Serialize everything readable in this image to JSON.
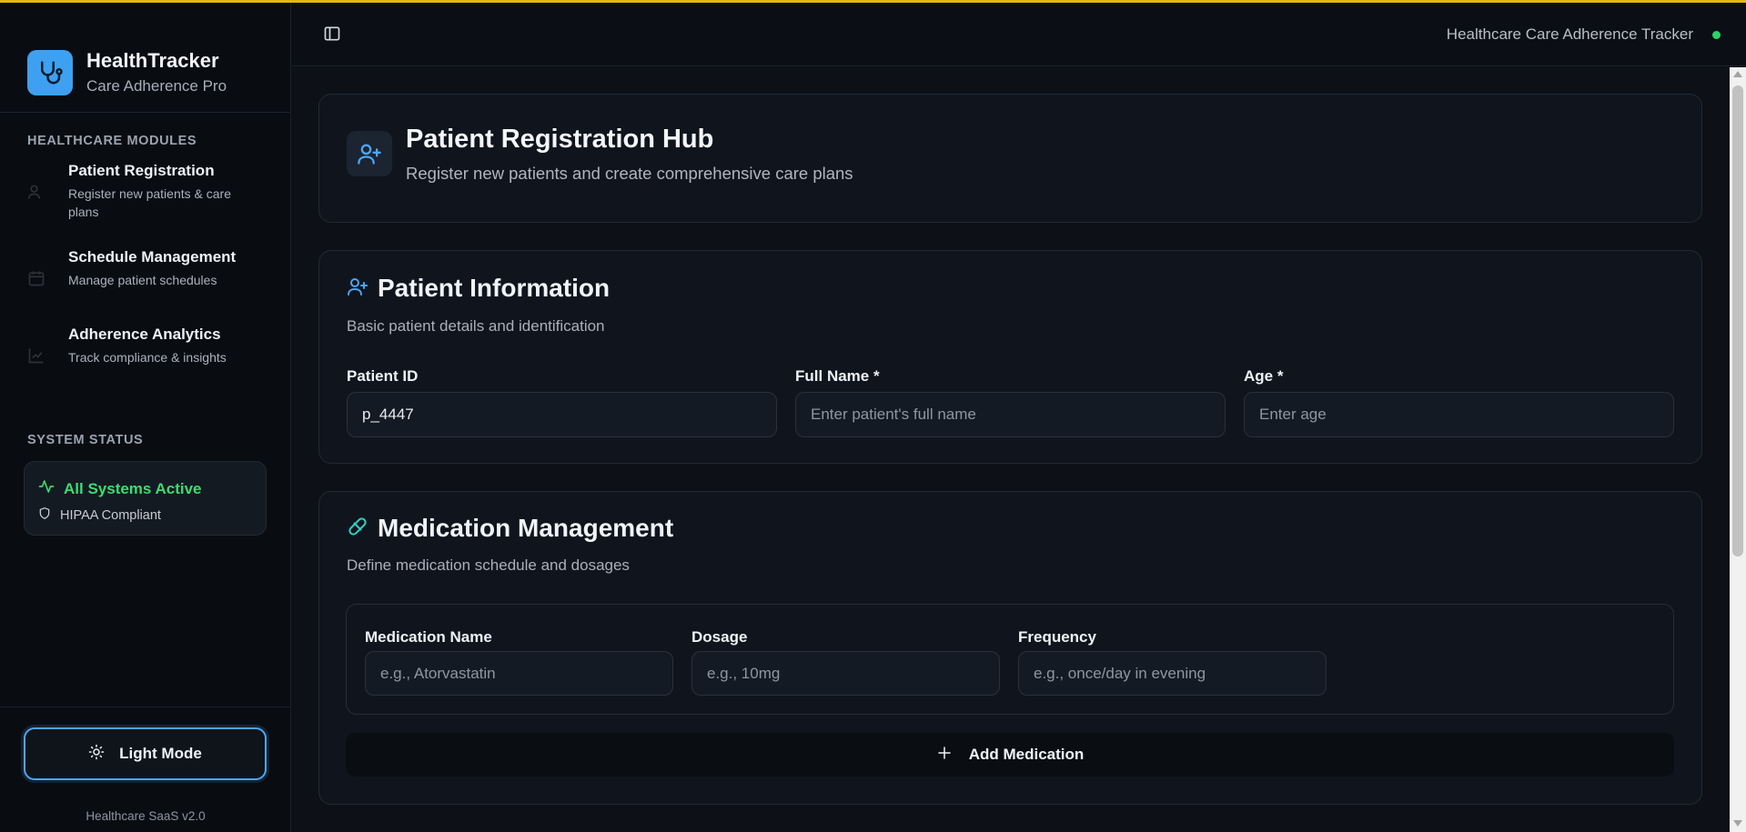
{
  "brand": {
    "title": "HealthTracker",
    "subtitle": "Care Adherence Pro",
    "accent": "#3ea0f0"
  },
  "sidebar": {
    "modules_label": "HEALTHCARE MODULES",
    "items": [
      {
        "title": "Patient Registration",
        "desc": "Register new patients & care plans",
        "icon": "user-plus-icon"
      },
      {
        "title": "Schedule Management",
        "desc": "Manage patient schedules",
        "icon": "calendar-icon"
      },
      {
        "title": "Adherence Analytics",
        "desc": "Track compliance & insights",
        "icon": "chart-icon"
      }
    ],
    "status_label": "SYSTEM STATUS",
    "status": {
      "active": "All Systems Active",
      "compliance": "HIPAA Compliant",
      "active_color": "#3ddc70"
    },
    "theme_button": "Light Mode",
    "version": "Healthcare SaaS v2.0"
  },
  "header": {
    "title": "Healthcare Care Adherence Tracker",
    "status_color": "#2ed16a"
  },
  "hero": {
    "title": "Patient Registration Hub",
    "subtitle": "Register new patients and create comprehensive care plans"
  },
  "patient_info": {
    "title": "Patient Information",
    "subtitle": "Basic patient details and identification",
    "fields": {
      "patient_id": {
        "label": "Patient ID",
        "value": "p_4447"
      },
      "full_name": {
        "label": "Full Name *",
        "placeholder": "Enter patient's full name"
      },
      "age": {
        "label": "Age *",
        "placeholder": "Enter age"
      }
    }
  },
  "medication": {
    "title": "Medication Management",
    "subtitle": "Define medication schedule and dosages",
    "fields": {
      "name": {
        "label": "Medication Name",
        "placeholder": "e.g., Atorvastatin"
      },
      "dosage": {
        "label": "Dosage",
        "placeholder": "e.g., 10mg"
      },
      "frequency": {
        "label": "Frequency",
        "placeholder": "e.g., once/day in evening"
      }
    },
    "add_button": "Add Medication"
  }
}
